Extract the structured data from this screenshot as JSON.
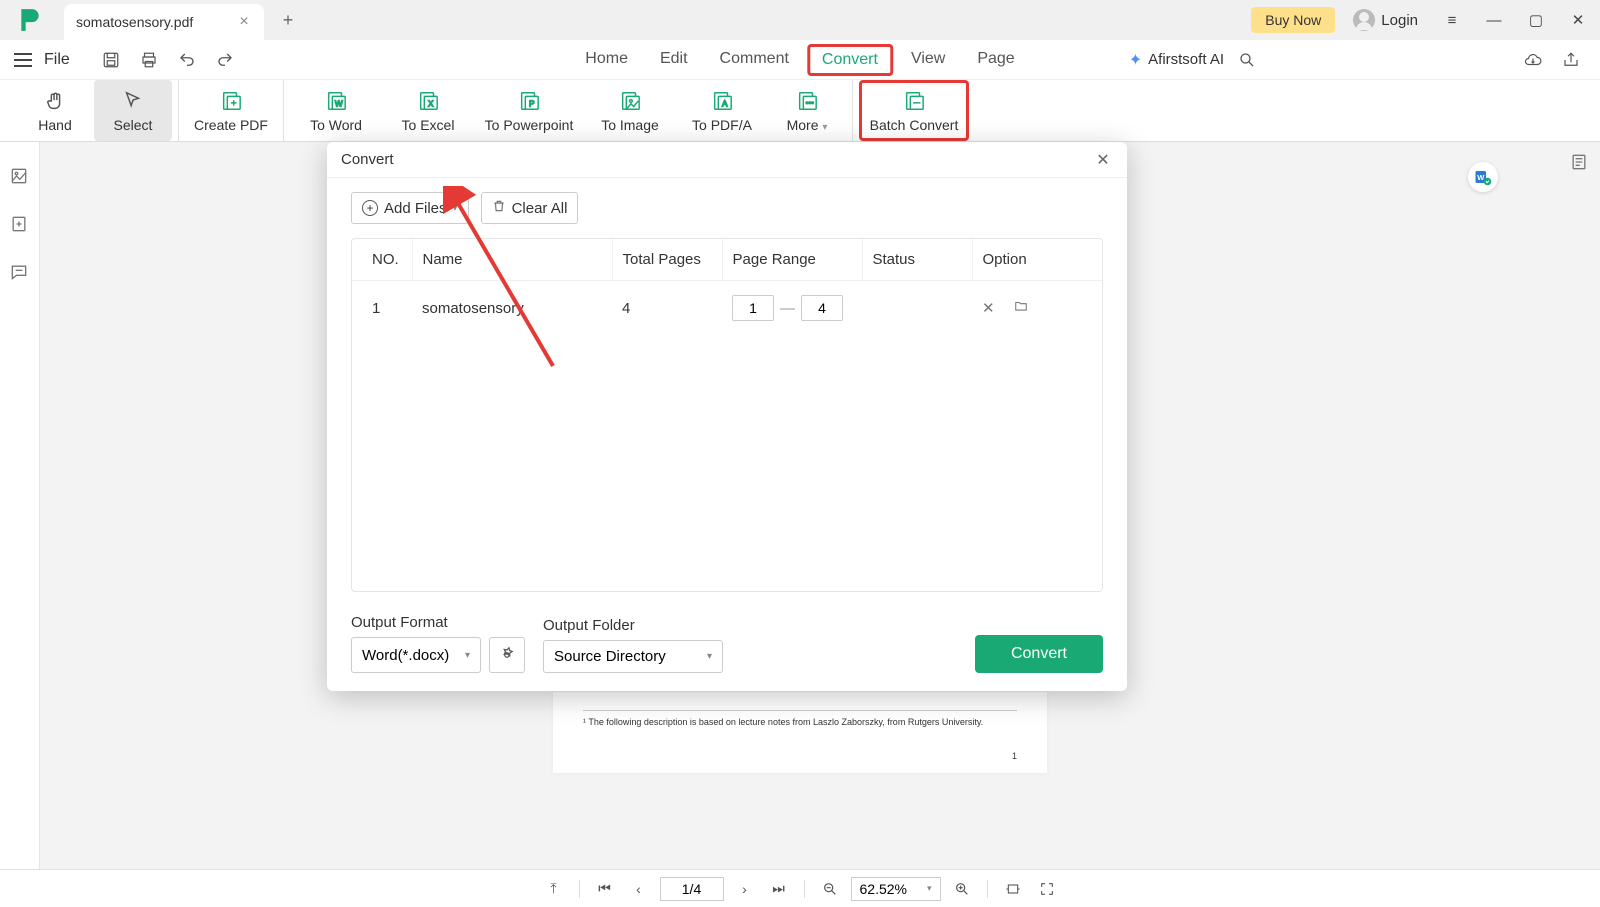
{
  "titlebar": {
    "tab_title": "somatosensory.pdf",
    "buy_now": "Buy Now",
    "login": "Login"
  },
  "menubar": {
    "file": "File"
  },
  "main_tabs": {
    "home": "Home",
    "edit": "Edit",
    "comment": "Comment",
    "convert": "Convert",
    "view": "View",
    "page": "Page"
  },
  "ai_label": "Afirstsoft AI",
  "ribbon": {
    "hand": "Hand",
    "select": "Select",
    "create_pdf": "Create PDF",
    "to_word": "To Word",
    "to_excel": "To Excel",
    "to_ppt": "To Powerpoint",
    "to_image": "To Image",
    "to_pdfa": "To PDF/A",
    "more": "More",
    "batch": "Batch Convert"
  },
  "dialog": {
    "title": "Convert",
    "add_files": "Add Files",
    "clear_all": "Clear All",
    "headers": {
      "no": "NO.",
      "name": "Name",
      "total_pages": "Total Pages",
      "page_range": "Page Range",
      "status": "Status",
      "option": "Option"
    },
    "rows": [
      {
        "no": "1",
        "name": "somatosensory",
        "total_pages": "4",
        "range_from": "1",
        "range_to": "4"
      }
    ],
    "output_format_label": "Output Format",
    "output_format_value": "Word(*.docx)",
    "output_folder_label": "Output Folder",
    "output_folder_value": "Source Directory",
    "convert_btn": "Convert"
  },
  "doc": {
    "footnote": "¹ The following description is based on lecture notes from Laszlo Zaborszky, from Rutgers University.",
    "pagenum": "1"
  },
  "statusbar": {
    "page": "1/4",
    "zoom": "62.52%"
  }
}
